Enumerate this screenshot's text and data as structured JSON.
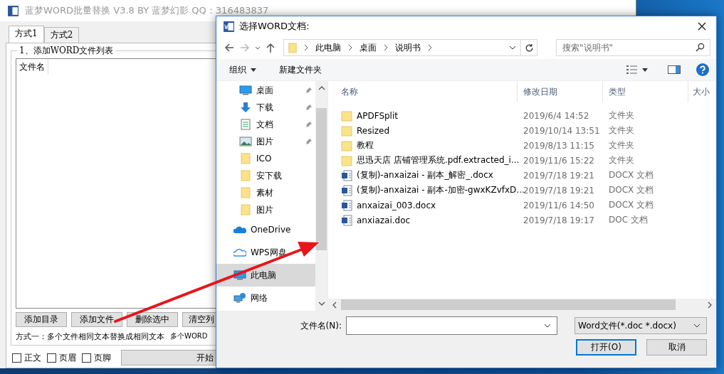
{
  "main_window": {
    "title": "蓝梦WORD批量替换 V3.8 BY 蓝梦幻影 QQ：316483837",
    "tabs": [
      {
        "label": "方式1",
        "selected": true
      },
      {
        "label": "方式2",
        "selected": false
      }
    ],
    "group_title": "1、添加WORD文件列表",
    "list_columns": [
      "文件名"
    ],
    "buttons": [
      "添加目录",
      "添加文件",
      "删除选中",
      "清空列"
    ],
    "hint": "方式一：多个文件相同文本替换成相同文本",
    "hint_2": "多个WORD",
    "checkboxes": [
      {
        "label": "正文",
        "checked": false
      },
      {
        "label": "页眉",
        "checked": false
      },
      {
        "label": "页脚",
        "checked": false
      }
    ],
    "start_button": "开始"
  },
  "dialog": {
    "title": "选择WORD文档:",
    "breadcrumbs": [
      "此电脑",
      "桌面",
      "说明书"
    ],
    "search": {
      "placeholder": "搜索\"说明书\""
    },
    "toolbar": {
      "organize": "组织",
      "new_folder": "新建文件夹"
    },
    "nav_items": [
      {
        "label": "桌面",
        "kind": "desktop",
        "pinned": true,
        "selected": false
      },
      {
        "label": "下载",
        "kind": "download",
        "pinned": true,
        "selected": false
      },
      {
        "label": "文档",
        "kind": "document",
        "pinned": true,
        "selected": false
      },
      {
        "label": "图片",
        "kind": "picture",
        "pinned": true,
        "selected": false
      },
      {
        "label": "ICO",
        "kind": "folder",
        "pinned": false,
        "selected": false
      },
      {
        "label": "安下载",
        "kind": "folder",
        "pinned": false,
        "selected": false
      },
      {
        "label": "素材",
        "kind": "folder",
        "pinned": false,
        "selected": false
      },
      {
        "label": "图片",
        "kind": "folder",
        "pinned": false,
        "selected": false
      },
      {
        "label": "OneDrive",
        "kind": "onedrive",
        "pinned": false,
        "selected": false
      },
      {
        "label": "WPS网盘",
        "kind": "cloud",
        "pinned": false,
        "selected": false
      },
      {
        "label": "此电脑",
        "kind": "computer",
        "pinned": false,
        "selected": true
      },
      {
        "label": "网络",
        "kind": "network",
        "pinned": false,
        "selected": false
      }
    ],
    "columns": [
      "名称",
      "修改日期",
      "类型",
      "大小"
    ],
    "files": [
      {
        "name": "APDFSplit",
        "date": "2019/6/4 14:52",
        "type": "文件夹",
        "kind": "folder"
      },
      {
        "name": "Resized",
        "date": "2019/10/14 13:51",
        "type": "文件夹",
        "kind": "folder"
      },
      {
        "name": "教程",
        "date": "2019/8/13 11:15",
        "type": "文件夹",
        "kind": "folder"
      },
      {
        "name": "思迅天店 店铺管理系统.pdf.extracted_i...",
        "date": "2019/11/6 15:22",
        "type": "文件夹",
        "kind": "folder"
      },
      {
        "name": "(复制)-anxaizai - 副本_解密_.docx",
        "date": "2019/7/18 19:21",
        "type": "DOCX 文档",
        "kind": "doc"
      },
      {
        "name": "(复制)-anxaizai - 副本-加密-gwxKZvfxD...",
        "date": "2019/7/18 19:21",
        "type": "DOCX 文档",
        "kind": "doc"
      },
      {
        "name": "anxaizai_003.docx",
        "date": "2019/11/6 14:50",
        "type": "DOCX 文档",
        "kind": "doc"
      },
      {
        "name": "anxiazai.doc",
        "date": "2019/7/18 19:17",
        "type": "DOC 文档",
        "kind": "doc"
      }
    ],
    "filename_label": "文件名(N):",
    "filter": "Word文件(*.doc *.docx)",
    "open_button": "打开(O)",
    "cancel_button": "取消"
  }
}
